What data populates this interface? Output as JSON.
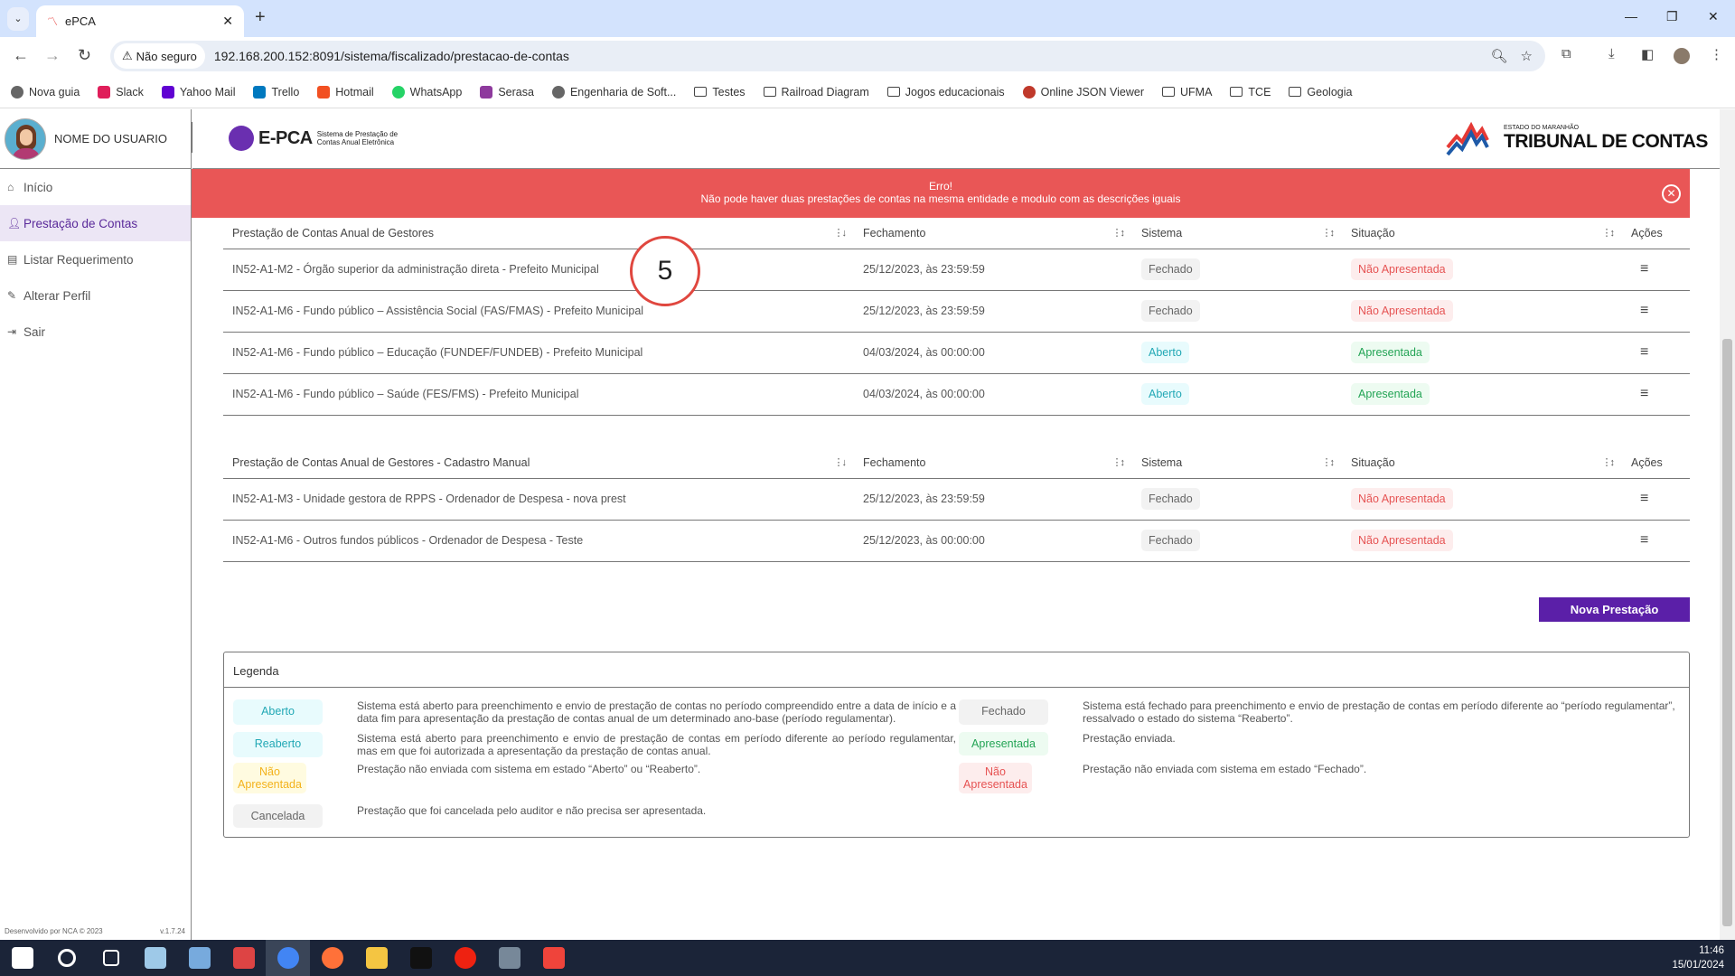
{
  "browser": {
    "tab_title": "ePCA",
    "security_label": "Não seguro",
    "url": "192.168.200.152:8091/sistema/fiscalizado/prestacao-de-contas",
    "bookmarks": [
      {
        "label": "Nova guia",
        "color": "#666"
      },
      {
        "label": "Slack",
        "color": "#e01e5a"
      },
      {
        "label": "Yahoo Mail",
        "color": "#6001d2"
      },
      {
        "label": "Trello",
        "color": "#0079bf"
      },
      {
        "label": "Hotmail",
        "color": "#f25022"
      },
      {
        "label": "WhatsApp",
        "color": "#25d366"
      },
      {
        "label": "Serasa",
        "color": "#8e3a9d"
      },
      {
        "label": "Engenharia de Soft...",
        "color": "#666"
      },
      {
        "label": "Testes",
        "color": "folder"
      },
      {
        "label": "Railroad Diagram",
        "color": "folder"
      },
      {
        "label": "Jogos educacionais",
        "color": "folder"
      },
      {
        "label": "Online JSON Viewer",
        "color": "#c0392b"
      },
      {
        "label": "UFMA",
        "color": "folder"
      },
      {
        "label": "TCE",
        "color": "folder"
      },
      {
        "label": "Geologia",
        "color": "folder"
      }
    ]
  },
  "sidebar": {
    "user_name": "NOME DO USUARIO",
    "items": [
      {
        "label": "Início",
        "icon": "home-icon"
      },
      {
        "label": "Prestação de Contas",
        "icon": "user-icon",
        "active": true
      },
      {
        "label": "Listar Requerimento",
        "icon": "document-icon"
      },
      {
        "label": "Alterar Perfil",
        "icon": "user-edit-icon"
      },
      {
        "label": "Sair",
        "icon": "logout-icon"
      }
    ],
    "footer": "Desenvolvido por NCA © 2023",
    "version": "v.1.7.24"
  },
  "header": {
    "logo_text": "E-PCA",
    "logo_subtitle_1": "Sistema de Prestação de",
    "logo_subtitle_2": "Contas Anual Eletrônica",
    "tce_small": "ESTADO DO MARANHÃO",
    "tce_title": "TRIBUNAL DE CONTAS"
  },
  "error": {
    "title": "Erro!",
    "message": "Não pode haver duas prestações de contas na mesma entidade e modulo com as descrições iguais"
  },
  "tables": [
    {
      "columns": [
        "Prestação de Contas Anual de Gestores",
        "Fechamento",
        "Sistema",
        "Situação",
        "Ações"
      ],
      "rows": [
        {
          "name": "IN52-A1-M2 - Órgão superior da administração direta - Prefeito Municipal",
          "fechamento": "25/12/2023, às 23:59:59",
          "sistema": "Fechado",
          "situacao": "Não Apresentada"
        },
        {
          "name": "IN52-A1-M6 - Fundo público – Assistência Social (FAS/FMAS) - Prefeito Municipal",
          "fechamento": "25/12/2023, às 23:59:59",
          "sistema": "Fechado",
          "situacao": "Não Apresentada"
        },
        {
          "name": "IN52-A1-M6 - Fundo público – Educação (FUNDEF/FUNDEB) - Prefeito Municipal",
          "fechamento": "04/03/2024, às 00:00:00",
          "sistema": "Aberto",
          "situacao": "Apresentada"
        },
        {
          "name": "IN52-A1-M6 - Fundo público – Saúde (FES/FMS) - Prefeito Municipal",
          "fechamento": "04/03/2024, às 00:00:00",
          "sistema": "Aberto",
          "situacao": "Apresentada"
        }
      ]
    },
    {
      "columns": [
        "Prestação de Contas Anual de Gestores - Cadastro Manual",
        "Fechamento",
        "Sistema",
        "Situação",
        "Ações"
      ],
      "rows": [
        {
          "name": "IN52-A1-M3 - Unidade gestora de RPPS - Ordenador de Despesa - nova prest",
          "fechamento": "25/12/2023, às 23:59:59",
          "sistema": "Fechado",
          "situacao": "Não Apresentada"
        },
        {
          "name": "IN52-A1-M6 - Outros fundos públicos - Ordenador de Despesa - Teste",
          "fechamento": "25/12/2023, às 00:00:00",
          "sistema": "Fechado",
          "situacao": "Não Apresentada"
        }
      ]
    }
  ],
  "nova_button": "Nova Prestação",
  "legend": {
    "title": "Legenda",
    "left": [
      {
        "badge": "Aberto",
        "cls": "b-aberto",
        "text": "Sistema está aberto para preenchimento e envio de prestação de contas no período compreendido entre a data de início e a data fim para apresentação da prestação de contas anual de um determinado ano-base (período regulamentar)."
      },
      {
        "badge": "Reaberto",
        "cls": "b-reaberto",
        "text": "Sistema está aberto para preenchimento e envio de prestação de contas em período diferente ao período regulamentar, mas em que foi autorizada a apresentação da prestação de contas anual."
      },
      {
        "badge": "Não Apresentada",
        "cls": "b-naoy",
        "text": "Prestação não enviada com sistema em estado “Aberto” ou “Reaberto”."
      },
      {
        "badge": "Cancelada",
        "cls": "b-canc",
        "text": "Prestação que foi cancelada pelo auditor e não precisa ser apresentada."
      }
    ],
    "right": [
      {
        "badge": "Fechado",
        "cls": "b-fechado",
        "text": "Sistema está fechado para preenchimento e envio de prestação de contas em período diferente ao “período regulamentar”, ressalvado o estado do sistema “Reaberto”."
      },
      {
        "badge": "Apresentada",
        "cls": "b-apres",
        "text": "Prestação enviada."
      },
      {
        "badge": "Não Apresentada",
        "cls": "b-nao",
        "text": "Prestação não enviada com sistema em estado “Fechado”."
      }
    ]
  },
  "annotation": "5",
  "clock": {
    "time": "11:46",
    "date": "15/01/2024"
  },
  "colors": {
    "accent": "#5b1fa8",
    "error": "#e95656"
  }
}
